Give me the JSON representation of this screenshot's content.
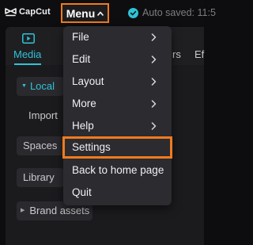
{
  "app": {
    "logo_text": "CapCut",
    "autosave_text": "Auto saved: 11:5",
    "accent_color": "#2fc3d6",
    "highlight_color": "#f07b1e"
  },
  "toolbar": {
    "menu_label": "Menu",
    "menu_icon": "chevron-up-icon"
  },
  "tabs": {
    "media_label": "Media",
    "stickers_partial": "rs",
    "effects_partial": "Ef"
  },
  "sidebar": {
    "local_label": "Local",
    "import_label": "Import",
    "spaces_label": "Spaces",
    "library_label": "Library",
    "brand_assets_label": "Brand assets"
  },
  "menu": {
    "items": [
      {
        "label": "File",
        "has_submenu": true
      },
      {
        "label": "Edit",
        "has_submenu": true
      },
      {
        "label": "Layout",
        "has_submenu": true
      },
      {
        "label": "More",
        "has_submenu": true
      },
      {
        "label": "Help",
        "has_submenu": true
      },
      {
        "label": "Settings",
        "has_submenu": false,
        "highlighted": true
      },
      {
        "label": "Back to home page",
        "has_submenu": false
      },
      {
        "label": "Quit",
        "has_submenu": false
      }
    ]
  }
}
